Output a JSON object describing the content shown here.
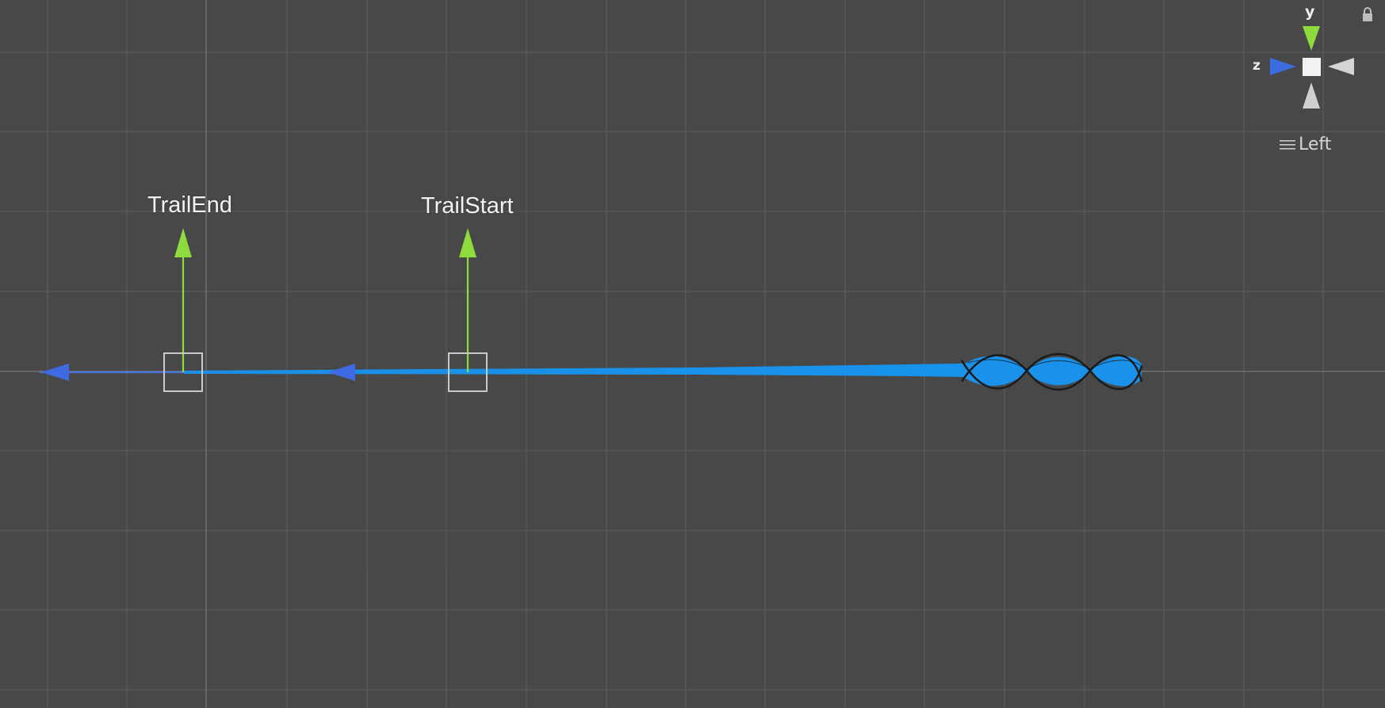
{
  "scene": {
    "objects": [
      {
        "name": "TrailEnd"
      },
      {
        "name": "TrailStart"
      }
    ],
    "trail_color": "#1a8fe8",
    "forward_arrow_color": "#3b6fe0",
    "up_arrow_color": "#8ddb3c",
    "grid_color": "#5a5a5a",
    "background_color": "#484848"
  },
  "view_gizmo": {
    "y_axis_label": "y",
    "z_axis_label": "z",
    "view_mode_label": "Left",
    "icons": [
      "lock-icon",
      "menu-icon"
    ]
  }
}
